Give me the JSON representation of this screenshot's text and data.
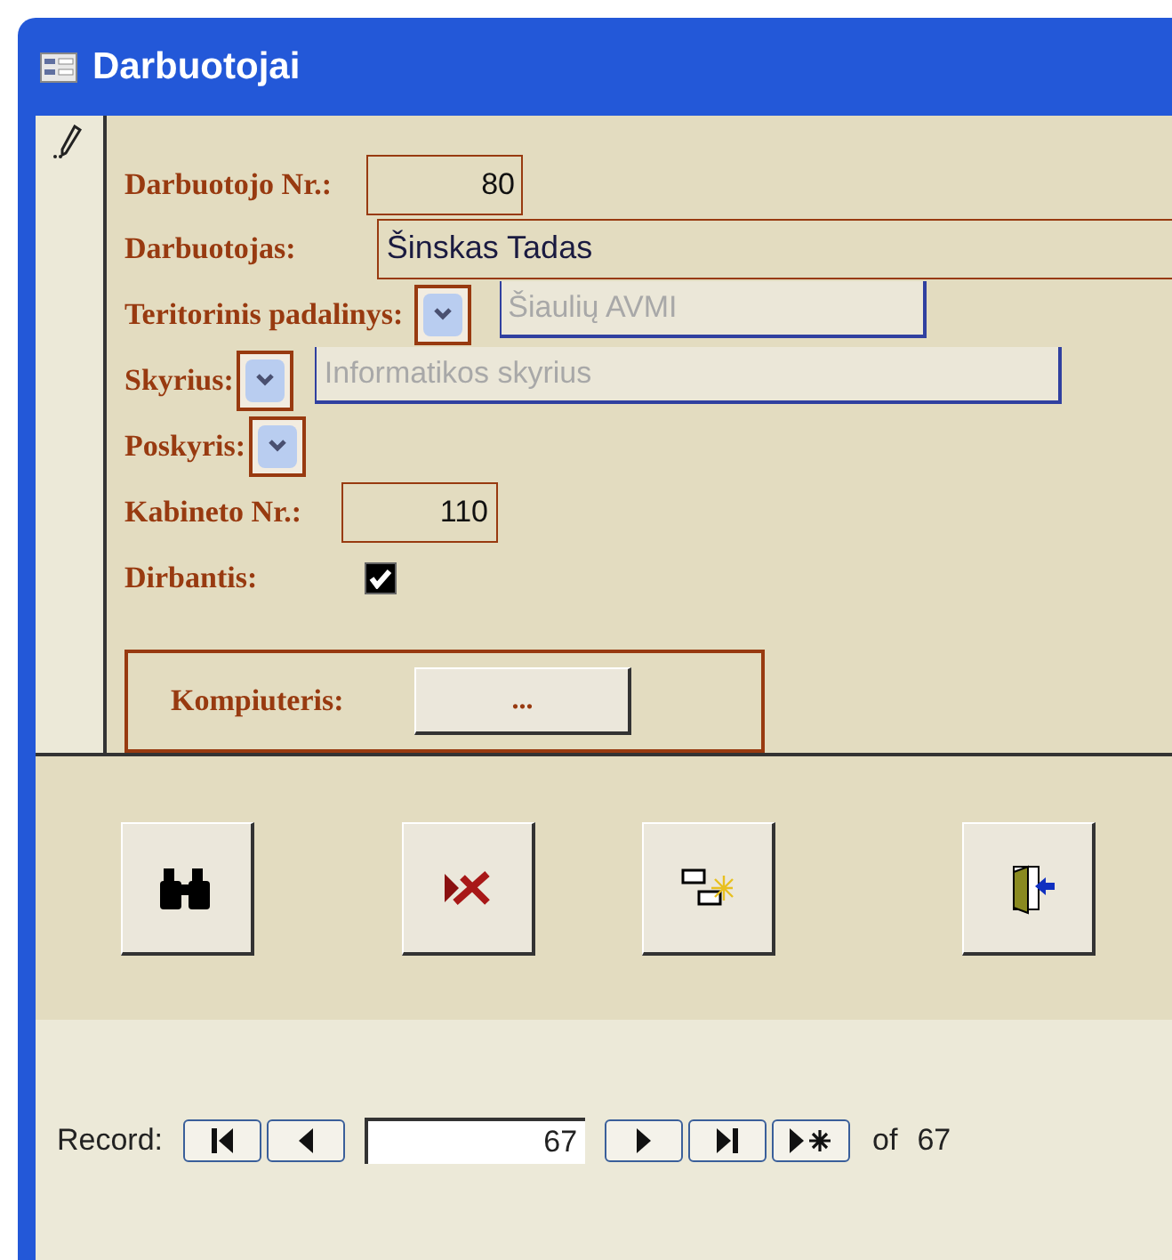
{
  "window": {
    "title": "Darbuotojai"
  },
  "fields": [
    {
      "kind": "number",
      "label": "Darbuotojo Nr.:",
      "value": "80"
    },
    {
      "kind": "text",
      "label": "Darbuotojas:",
      "value": "Šinskas Tadas"
    },
    {
      "kind": "combo",
      "label": "Teritorinis padalinys:",
      "value": "Šiaulių AVMI",
      "disabled": true
    },
    {
      "kind": "combo",
      "label": "Skyrius:",
      "value": "Informatikos skyrius",
      "disabled": true
    },
    {
      "kind": "combo",
      "label": "Poskyris:"
    },
    {
      "kind": "number",
      "label": "Kabineto Nr.:",
      "value": "110"
    },
    {
      "kind": "checkbox",
      "label": "Dirbantis:",
      "checked": true
    }
  ],
  "subform": {
    "label": "Kompiuteris:",
    "button": "..."
  },
  "record_nav": {
    "label": "Record:",
    "current": "67",
    "of_label": "of",
    "total": "67"
  }
}
